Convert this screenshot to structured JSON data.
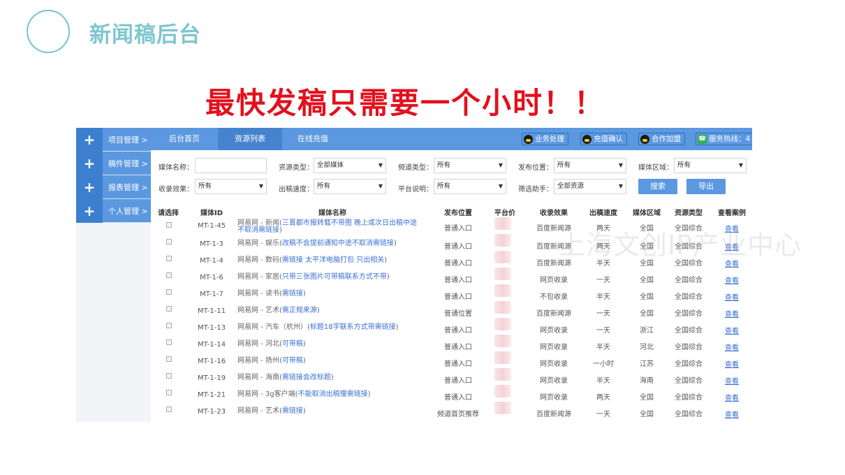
{
  "slide": {
    "title": "新闻稿后台",
    "headline": "最快发稿只需要一个小时！！",
    "watermark": "上海文创IP产业中心"
  },
  "sidebar": {
    "items": [
      {
        "plus": "+",
        "label": "项目管理 >"
      },
      {
        "plus": "+",
        "label": "稿件管理 >"
      },
      {
        "plus": "+",
        "label": "报表管理 >"
      },
      {
        "plus": "+",
        "label": "个人管理 >"
      }
    ]
  },
  "topbar": {
    "tabs": [
      "后台首页",
      "资源列表",
      "在线充值"
    ],
    "active_tab": "资源列表",
    "buttons": [
      "业务处理",
      "充值确认",
      "合作加盟"
    ],
    "hotline": "服务热线：4"
  },
  "filters": {
    "media_name": {
      "label": "媒体名称：",
      "value": ""
    },
    "resource_type": {
      "label": "资源类型：",
      "value": "全部媒体"
    },
    "channel_type": {
      "label": "频道类型：",
      "value": "所有"
    },
    "position": {
      "label": "发布位置：",
      "value": "所有"
    },
    "region": {
      "label": "媒体区域：",
      "value": "所有"
    },
    "indexing": {
      "label": "收录效果：",
      "value": "所有"
    },
    "speed": {
      "label": "出稿速度：",
      "value": "所有"
    },
    "platform_note": {
      "label": "平台说明：",
      "value": "所有"
    },
    "helper": {
      "label": "筛选助手：",
      "value": "全部资源"
    },
    "search_label": "搜索",
    "export_label": "导出"
  },
  "table": {
    "headers": [
      "请选择",
      "媒体ID",
      "媒体名称",
      "发布位置",
      "平台价",
      "收录效果",
      "出稿速度",
      "媒体区域",
      "资源类型",
      "查看案例"
    ],
    "rows": [
      {
        "id": "MT-1-45",
        "name": "网易网 - 新闻(",
        "note": "三晋都市报转载不带图 晚上或次日出稿中途不取消需链接",
        "tail": ")",
        "position": "普通入口",
        "indexing": "百度新闻源",
        "speed": "两天",
        "region": "全国",
        "type": "全国综合",
        "view": "查看"
      },
      {
        "id": "MT-1-3",
        "name": "网易网 - 娱乐(",
        "note": "改稿不会提前通知中途不取消需链接",
        "tail": ")",
        "position": "普通入口",
        "indexing": "百度新闻源",
        "speed": "两天",
        "region": "全国",
        "type": "全国综合",
        "view": "查看"
      },
      {
        "id": "MT-1-4",
        "name": "网易网 - 数码(",
        "note": "需链接 太平洋电脑打包 只出相关",
        "tail": ")",
        "position": "普通入口",
        "indexing": "百度新闻源",
        "speed": "半天",
        "region": "全国",
        "type": "全国综合",
        "view": "查看"
      },
      {
        "id": "MT-1-6",
        "name": "网易网 - 家居(",
        "note": "只带三张图片可带稿联系方式不带",
        "tail": ")",
        "position": "普通入口",
        "indexing": "网页收录",
        "speed": "一天",
        "region": "全国",
        "type": "全国综合",
        "view": "查看"
      },
      {
        "id": "MT-1-7",
        "name": "网易网 - 读书(",
        "note": "需链接",
        "tail": ")",
        "position": "普通入口",
        "indexing": "不包收录",
        "speed": "半天",
        "region": "全国",
        "type": "全国综合",
        "view": "查看"
      },
      {
        "id": "MT-1-11",
        "name": "网易网 - 艺术(",
        "note": "需正规来源",
        "tail": ")",
        "position": "普通位置",
        "indexing": "百度新闻源",
        "speed": "一天",
        "region": "全国",
        "type": "全国综合",
        "view": "查看"
      },
      {
        "id": "MT-1-13",
        "name": "网易网 - 汽车（杭州）(",
        "note": "标题18字联系方式带需链接",
        "tail": ")",
        "position": "普通入口",
        "indexing": "网页收录",
        "speed": "一天",
        "region": "浙江",
        "type": "全国综合",
        "view": "查看"
      },
      {
        "id": "MT-1-14",
        "name": "网易网 - 河北(",
        "note": "可带稿",
        "tail": ")",
        "position": "普通入口",
        "indexing": "网页收录",
        "speed": "半天",
        "region": "河北",
        "type": "全国综合",
        "view": "查看"
      },
      {
        "id": "MT-1-16",
        "name": "网易网 - 扬州(",
        "note": "可带稿",
        "tail": ")",
        "position": "普通入口",
        "indexing": "网页收录",
        "speed": "一小时",
        "region": "江苏",
        "type": "全国综合",
        "view": "查看"
      },
      {
        "id": "MT-1-19",
        "name": "网易网 - 海南(",
        "note": "需链接会改标题",
        "tail": ")",
        "position": "普通入口",
        "indexing": "网页收录",
        "speed": "半天",
        "region": "海南",
        "type": "全国综合",
        "view": "查看"
      },
      {
        "id": "MT-1-21",
        "name": "网易网 - 3g客户端(",
        "note": "不能取消出稿慢需链接",
        "tail": ")",
        "position": "普通入口",
        "indexing": "网页收录",
        "speed": "两天",
        "region": "全国",
        "type": "全国综合",
        "view": "查看"
      },
      {
        "id": "MT-1-23",
        "name": "网易网 - 艺术(",
        "note": "需链接",
        "tail": ")",
        "position": "频道首页推荐",
        "indexing": "百度新闻源",
        "speed": "一天",
        "region": "全国",
        "type": "全国综合",
        "view": "查看"
      }
    ]
  }
}
